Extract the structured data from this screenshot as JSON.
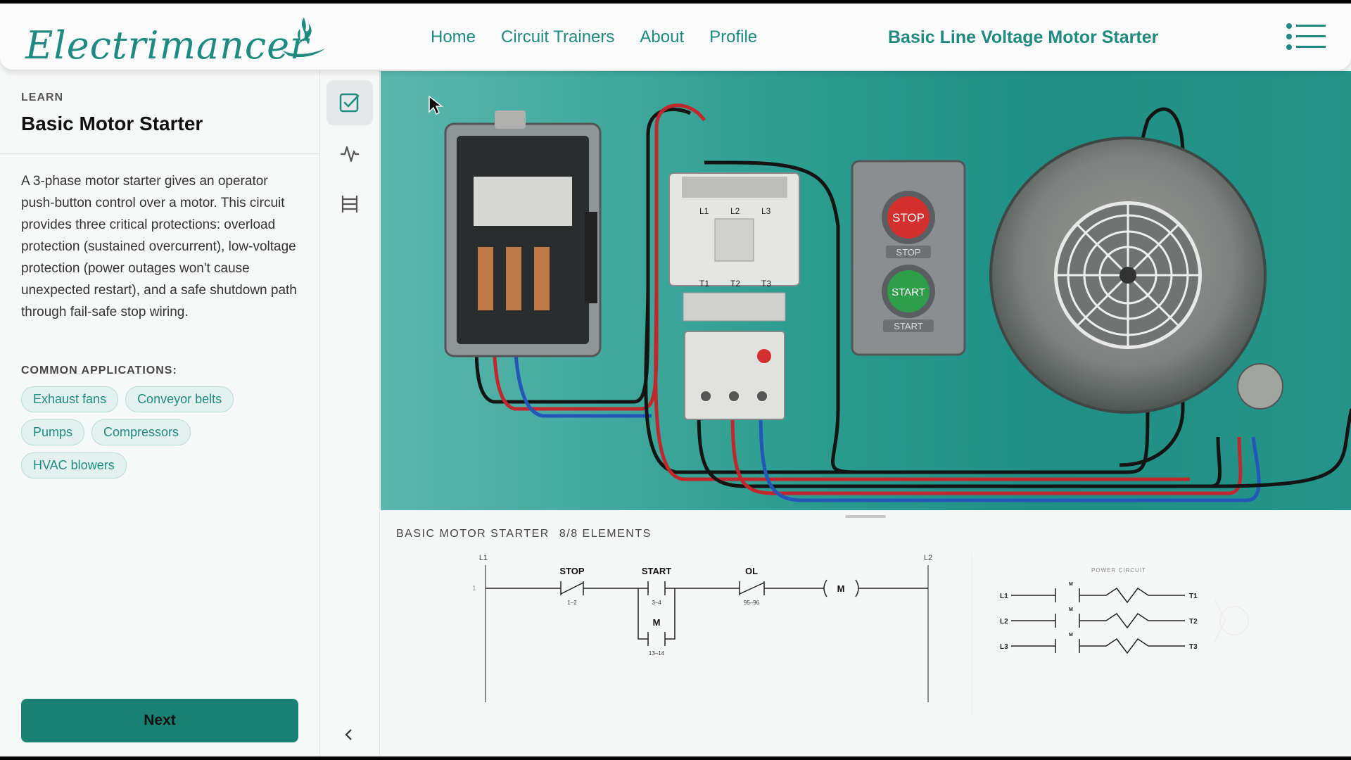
{
  "app": {
    "logo_text": "Electrimancer"
  },
  "nav": {
    "items": [
      "Home",
      "Circuit Trainers",
      "About",
      "Profile"
    ]
  },
  "header": {
    "page_title": "Basic Line Voltage Motor Starter"
  },
  "lesson": {
    "section_label": "LEARN",
    "title": "Basic Motor Starter",
    "description": "A 3-phase motor starter gives an operator push-button control over a motor. This circuit provides three critical protections: overload protection (sustained overcurrent), low-voltage protection (power outages won't cause unexpected restart), and a safe shutdown path through fail-safe stop wiring.",
    "applications_label": "COMMON APPLICATIONS:",
    "applications": [
      "Exhaust fans",
      "Conveyor belts",
      "Pumps",
      "Compressors",
      "HVAC blowers"
    ],
    "next_label": "Next"
  },
  "rail": {
    "icons": [
      "checklist-icon",
      "waveform-icon",
      "ladder-icon"
    ],
    "collapse_icon": "chevron-left-icon"
  },
  "canvas": {
    "stop_label": "STOP",
    "start_label": "START",
    "contactor_terminals_top": [
      "L1",
      "L2",
      "L3"
    ],
    "contactor_terminals_bottom": [
      "T1",
      "T2",
      "T3"
    ]
  },
  "schematic": {
    "title": "BASIC MOTOR STARTER",
    "elements": "8/8 ELEMENTS",
    "ladder": {
      "left_rail": "L1",
      "right_rail": "L2",
      "rung_number": "1",
      "stop_label": "STOP",
      "stop_terminals": "1–2",
      "start_label": "START",
      "start_terminals": "3–4",
      "seal_label": "M",
      "seal_terminals": "13–14",
      "ol_label": "OL",
      "ol_terminals": "95–96",
      "coil_label": "M"
    },
    "power_circuit": {
      "title": "POWER CIRCUIT",
      "lines": [
        {
          "in": "L1",
          "contact": "M",
          "out": "T1"
        },
        {
          "in": "L2",
          "contact": "M",
          "out": "T2"
        },
        {
          "in": "L3",
          "contact": "M",
          "out": "T3"
        }
      ]
    }
  },
  "colors": {
    "brand": "#1f8a80",
    "button": "#1a8074",
    "chip_bg": "#e4f2ef",
    "stop_red": "#d32f2f",
    "start_green": "#2e9e4a"
  }
}
